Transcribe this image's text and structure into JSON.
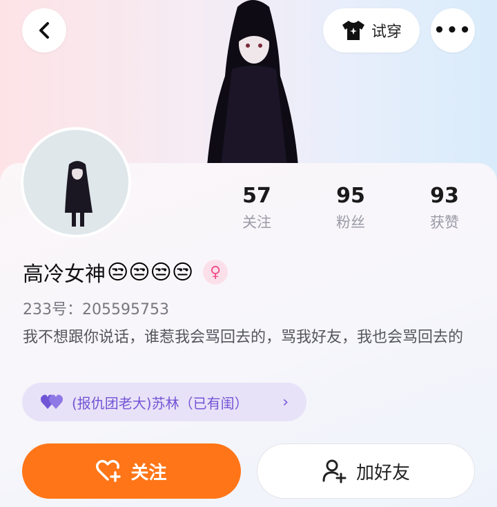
{
  "header": {
    "tryon_label": "试穿"
  },
  "stats": [
    {
      "value": "57",
      "label": "关注"
    },
    {
      "value": "95",
      "label": "粉丝"
    },
    {
      "value": "93",
      "label": "获赞"
    }
  ],
  "profile": {
    "name": "高冷女神",
    "name_emojis": "😒😒😒😒",
    "gender_symbol": "♀",
    "uid": "233号：205595753",
    "bio": "我不想跟你说话，谁惹我会骂回去的，骂我好友，我也会骂回去的"
  },
  "relation": {
    "text": "(报仇团老大)苏林（已有闺）",
    "chevron": "›"
  },
  "actions": {
    "follow_label": "关注",
    "add_friend_label": "加好友"
  },
  "colors": {
    "accent": "#ff7517",
    "relation_bg": "#e8e2f8",
    "relation_text": "#7454d6",
    "gender": "#f0508a"
  }
}
